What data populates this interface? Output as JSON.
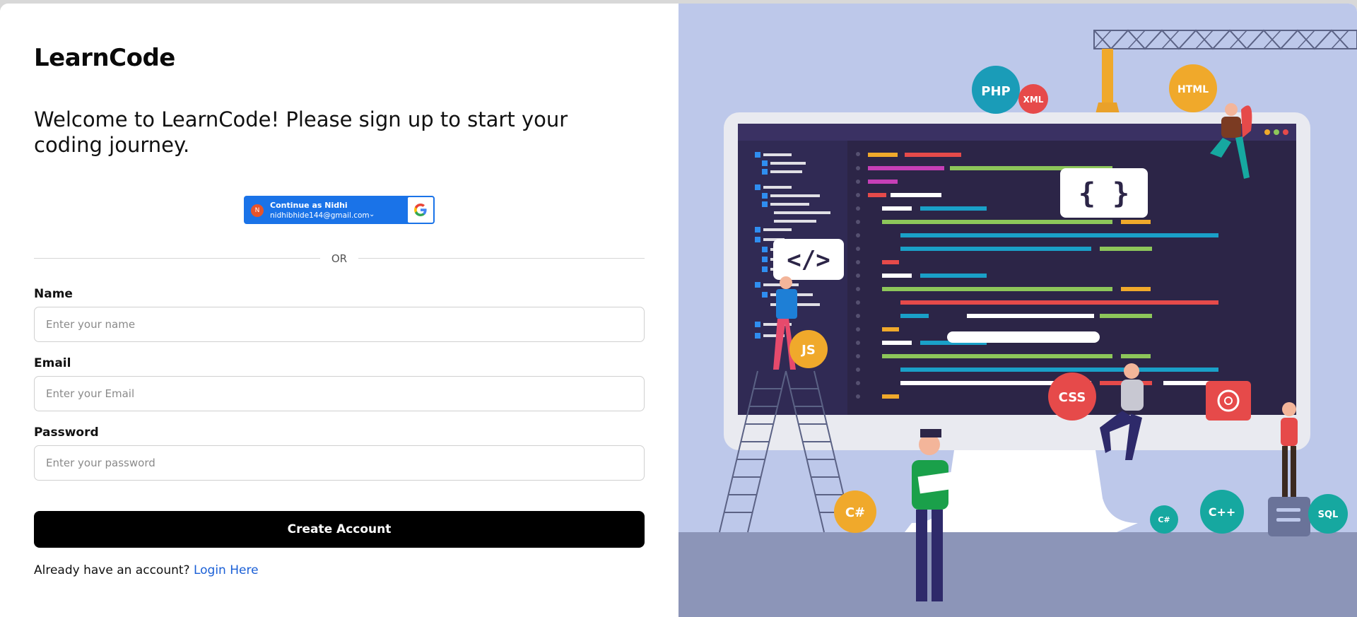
{
  "brand": "LearnCode",
  "welcome": "Welcome to LearnCode! Please sign up to start your coding journey.",
  "google": {
    "avatar_letter": "N",
    "line1": "Continue as Nidhi",
    "line2": "nidhibhide144@gmail.com",
    "chevron": "⌄"
  },
  "divider": "OR",
  "form": {
    "name_label": "Name",
    "name_placeholder": "Enter your name",
    "email_label": "Email",
    "email_placeholder": "Enter your Email",
    "password_label": "Password",
    "password_placeholder": "Enter your password",
    "submit_label": "Create Account"
  },
  "footer": {
    "text": "Already have an account?",
    "link": "Login Here"
  },
  "illustration": {
    "badges": [
      "PHP",
      "XML",
      "HTML",
      "JS",
      "CSS",
      "C#",
      "C#",
      "C++",
      "SQL"
    ],
    "braces": "{   }",
    "tag": "</>"
  },
  "colors": {
    "accent_google": "#1a73e8",
    "button": "#000000",
    "link": "#1a5fd6",
    "illustration_bg": "#bdc8ea",
    "screen_bg": "#2c2547"
  }
}
